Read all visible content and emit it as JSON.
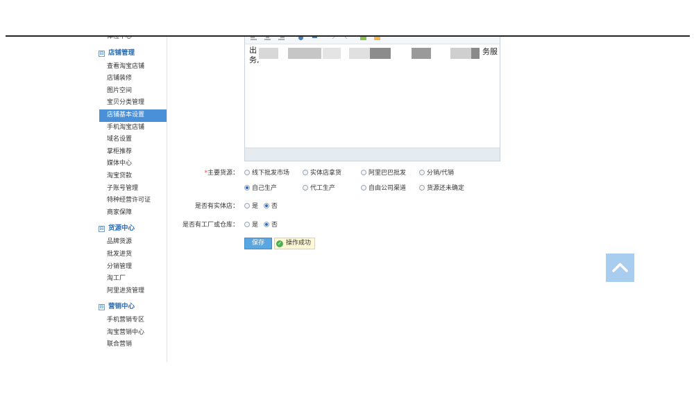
{
  "sidebar": {
    "top_items": [
      "体检中心"
    ],
    "groups": [
      {
        "title": "店铺管理",
        "toggle": "⊟",
        "items": [
          "查看淘宝店铺",
          "店铺装修",
          "图片空间",
          "宝贝分类管理",
          "店铺基本设置",
          "手机淘宝店铺",
          "域名设置",
          "掌柜推荐",
          "媒体中心",
          "淘宝贷款",
          "子账号管理",
          "特种经营许可证",
          "商家保障"
        ],
        "active": "店铺基本设置"
      },
      {
        "title": "货源中心",
        "toggle": "⊟",
        "items": [
          "品牌货源",
          "批发进货",
          "分销管理",
          "淘工厂",
          "阿里进货管理"
        ]
      },
      {
        "title": "营销中心",
        "toggle": "⊟",
        "items": [
          "手机营销专区",
          "淘宝营销中心",
          "联合营销"
        ]
      }
    ]
  },
  "editor": {
    "text_line1": "出",
    "text_line2": "务,",
    "text_right": "务服"
  },
  "form": {
    "source": {
      "required_mark": "*",
      "label": "主要货源：",
      "options": [
        "线下批发市场",
        "实体店拿货",
        "阿里巴巴批发",
        "分销/代销",
        "自己生产",
        "代工生产",
        "自由公司渠道",
        "货源还未确定"
      ],
      "selected": "自己生产"
    },
    "physical_store": {
      "label": "是否有实体店：",
      "yes": "是",
      "no": "否",
      "selected": "否"
    },
    "factory": {
      "label": "是否有工厂或仓库：",
      "yes": "是",
      "no": "否",
      "selected": "否"
    },
    "save_label": "保存",
    "success_text": "操作成功"
  },
  "icons": {
    "to_top": "chevron-up-icon",
    "success": "check-circle-icon"
  },
  "colors": {
    "accent": "#4a90d9",
    "group_title": "#2a6db5",
    "required": "#ee4444",
    "to_top_bg": "#a9cdee"
  }
}
